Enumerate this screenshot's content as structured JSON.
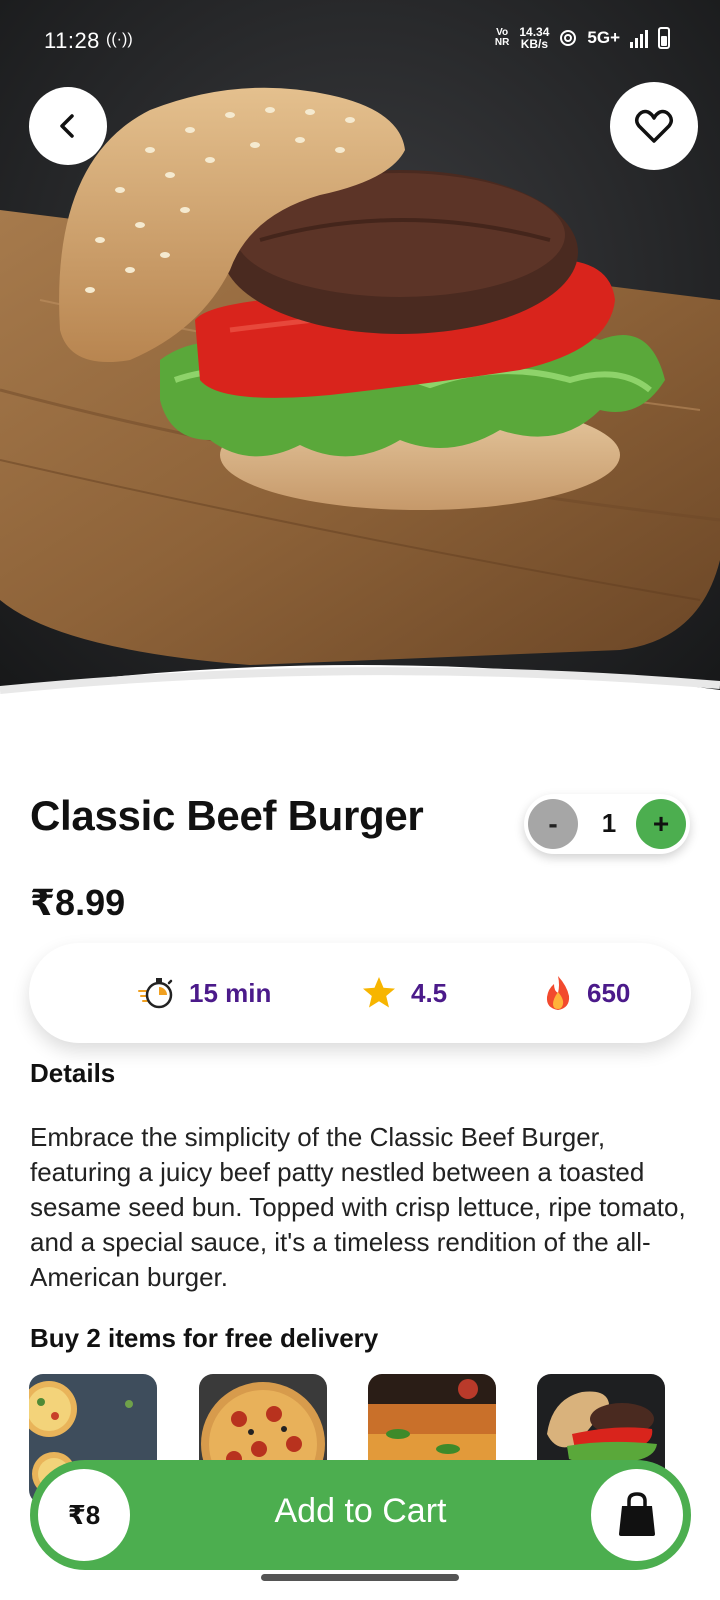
{
  "status_bar": {
    "time": "11:28",
    "hotspot_icon": "((·))",
    "volte": "Vo\nNR",
    "speed_value": "14.34",
    "speed_unit": "KB/s",
    "network": "5G+"
  },
  "hero": {
    "image_subject": "classic beef burger on a wooden board",
    "back_icon": "chevron-left-icon",
    "favorite_icon": "heart-outline-icon"
  },
  "product": {
    "title": "Classic Beef Burger",
    "price": "₹8.99",
    "quantity": "1",
    "minus_label": "-",
    "plus_label": "+"
  },
  "info": {
    "time": "15 min",
    "rating": "4.5",
    "calories": "650"
  },
  "details": {
    "heading": "Details",
    "text": "Embrace the simplicity of the Classic Beef Burger, featuring a juicy beef patty nestled between a toasted sesame seed bun. Topped with crisp lettuce, ripe tomato, and a special sauce, it's a timeless rendition of the all-American burger."
  },
  "promo": {
    "heading": "Buy 2 items for free delivery",
    "thumbnails": [
      "pizza slices",
      "pepperoni pizza",
      "jalapeño pizza",
      "beef burger"
    ]
  },
  "cart": {
    "price": "₹8",
    "label": "Add to Cart"
  },
  "colors": {
    "accent_green": "#4cae4f",
    "info_text_purple": "#4b1a8a",
    "minus_gray": "#a6a6a6"
  }
}
